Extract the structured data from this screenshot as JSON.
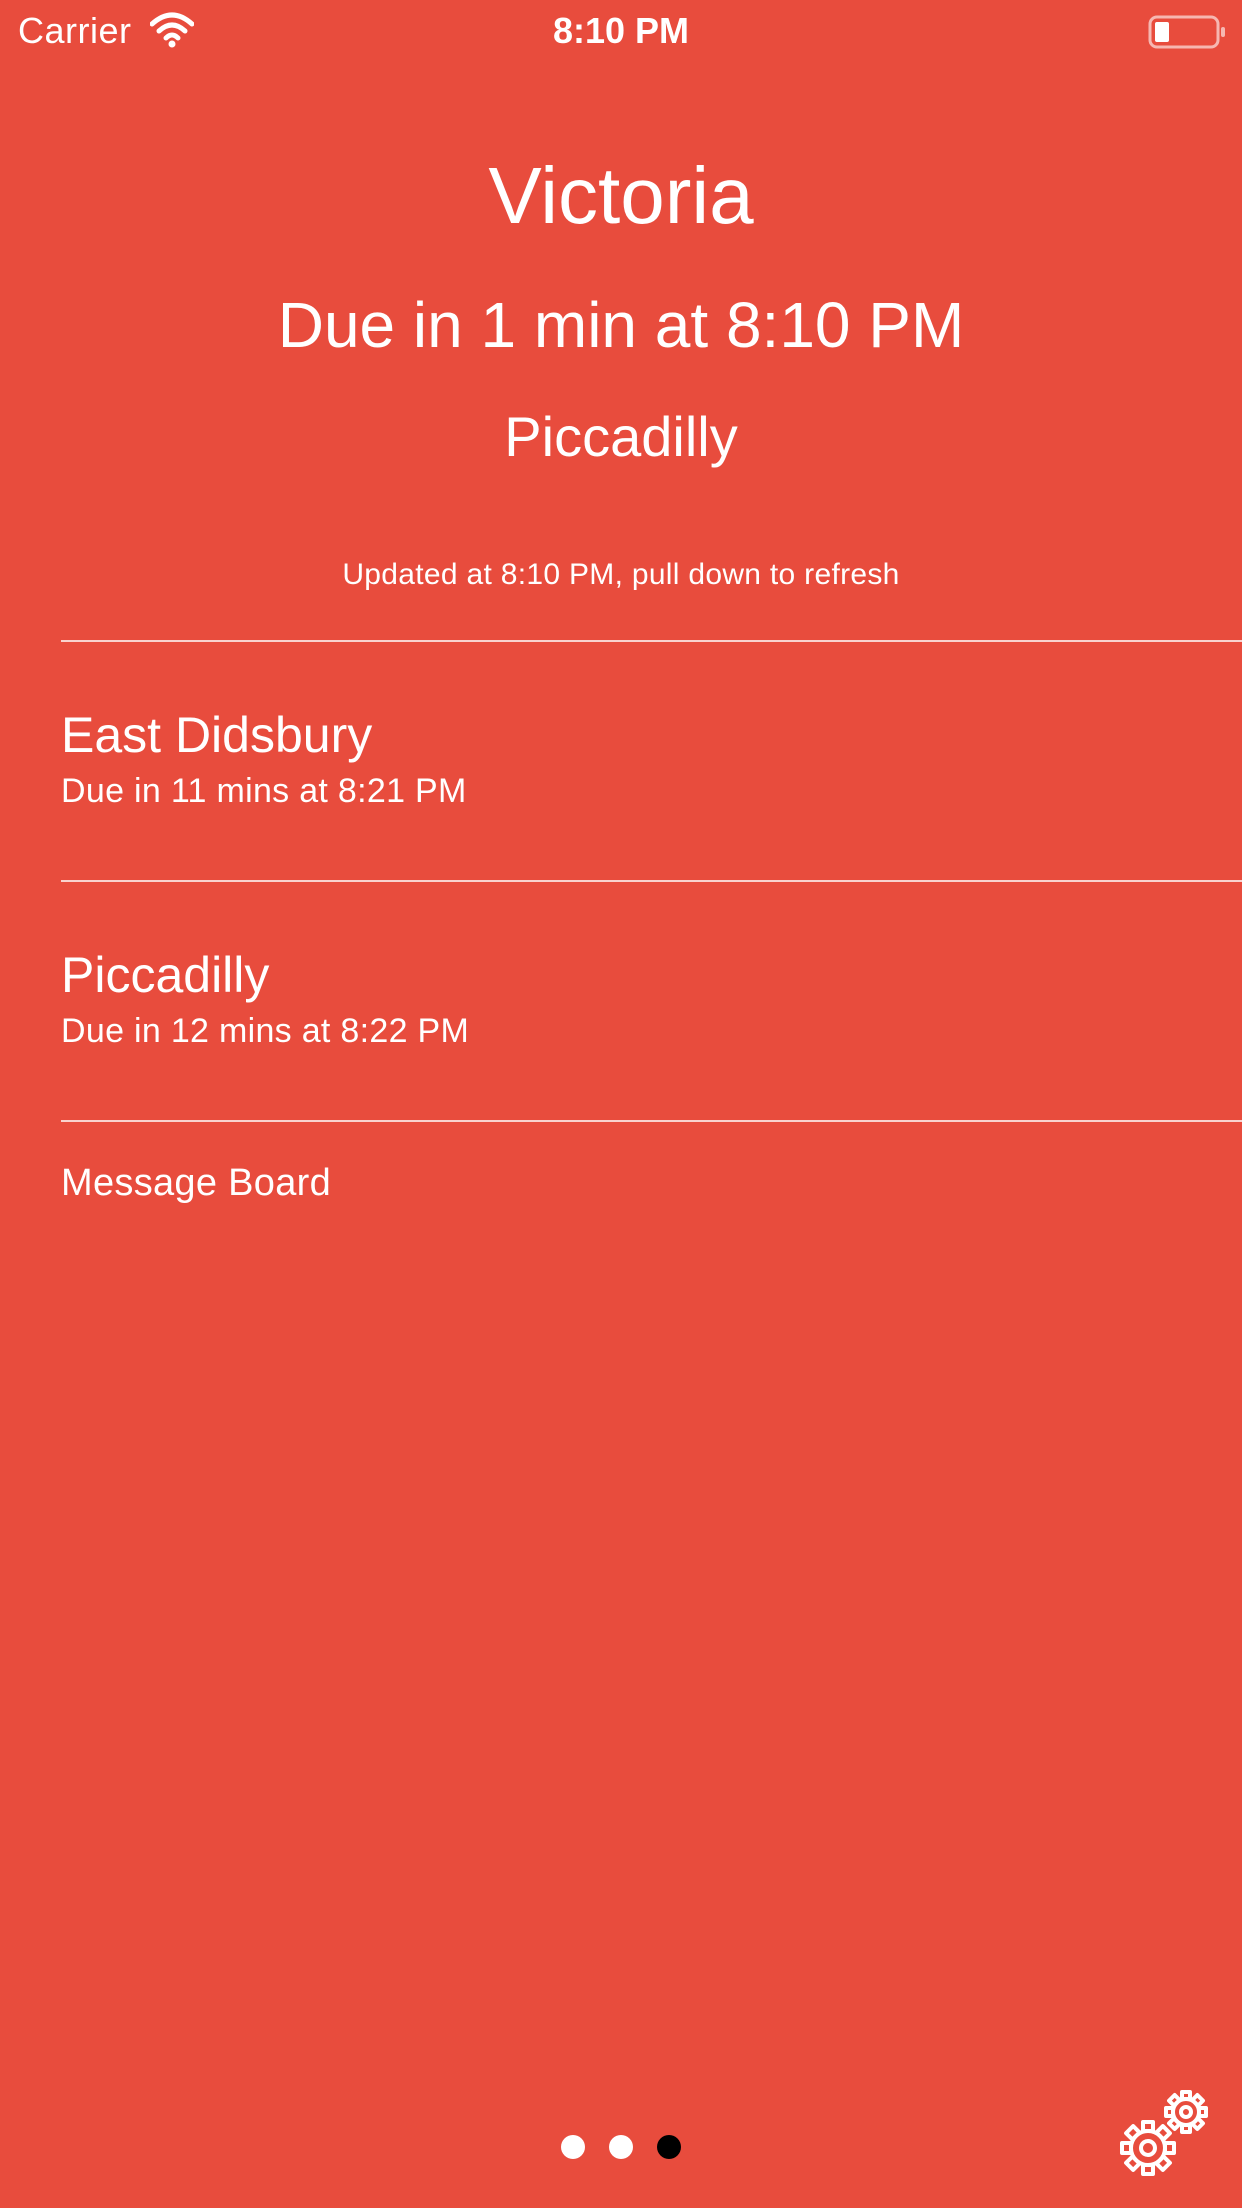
{
  "status_bar": {
    "carrier": "Carrier",
    "time": "8:10 PM"
  },
  "header": {
    "station": "Victoria",
    "next_due": "Due in 1 min at 8:10 PM",
    "next_destination": "Piccadilly",
    "updated": "Updated at 8:10 PM, pull down to refresh"
  },
  "departures": [
    {
      "destination": "East Didsbury",
      "due": "Due in 11 mins at 8:21 PM"
    },
    {
      "destination": "Piccadilly",
      "due": "Due in 12 mins at 8:22 PM"
    }
  ],
  "message_board": {
    "label": "Message Board"
  },
  "page_control": {
    "page_count": 3,
    "current_page": 3
  },
  "icons": {
    "wifi": "wifi-icon",
    "battery": "battery-low-icon",
    "settings": "gears-icon"
  },
  "colors": {
    "background": "#E84C3D",
    "text": "#FFFFFF",
    "active_dot": "#000000"
  }
}
